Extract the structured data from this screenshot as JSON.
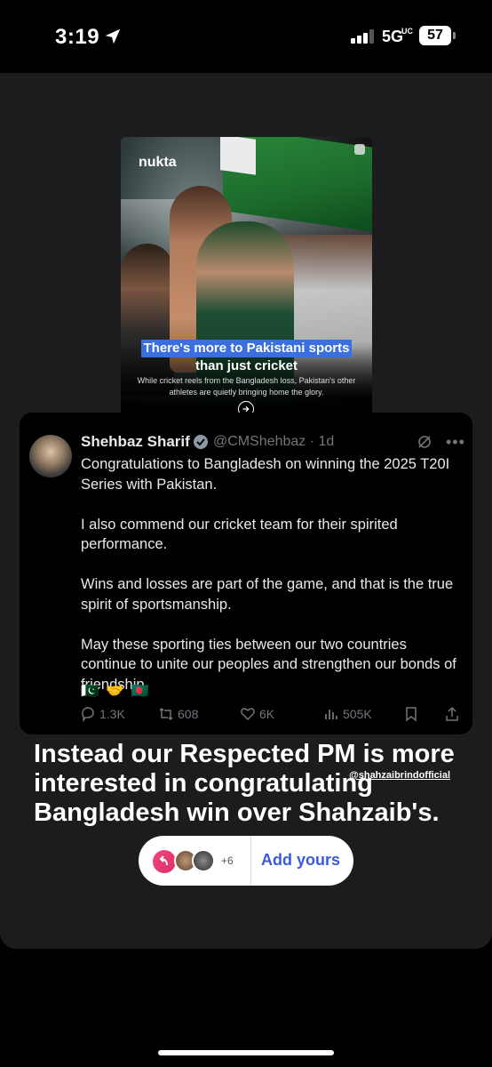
{
  "status_bar": {
    "time": "3:19",
    "network": "5G",
    "network_sub": "UC",
    "battery": "57"
  },
  "article": {
    "brand": "nukta",
    "headline_line1": "There's more to Pakistani sports",
    "headline_line2": "than just cricket",
    "subtext": "While cricket reels from the Bangladesh loss, Pakistan's other athletes are quietly bringing home the glory."
  },
  "tweet": {
    "name": "Shehbaz Sharif",
    "handle": "@CMShehbaz · 1d",
    "body": "Congratulations to Bangladesh on winning the 2025 T20I Series with Pakistan.\n\nI also commend our cricket team for their spirited performance.\n\nWins and losses are part of the game, and that is the true spirit of sportsmanship.\n\nMay these sporting ties between our two countries continue to unite our peoples and strengthen our bonds of friendship.",
    "emoji": "🇵🇰 🤝 🇧🇩",
    "replies": "1.3K",
    "retweets": "608",
    "likes": "6K",
    "views": "505K"
  },
  "caption": "Instead our Respected PM is more interested in congratulating Bangladesh win over Shahzaib's.",
  "sticker": {
    "count": "+6",
    "label": "Add yours"
  },
  "mention": "@shahzaibrindofficial",
  "colors": {
    "link_blue": "#3a5bd9",
    "highlight_blue": "#3b6fe0",
    "tweet_gray": "#71767b"
  }
}
